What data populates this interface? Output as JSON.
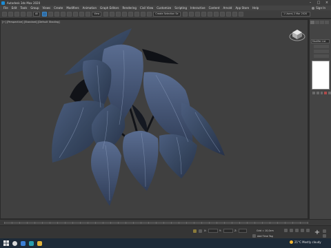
{
  "window": {
    "title": "Autodesk 3ds Max 2020"
  },
  "menubar": {
    "items": [
      "File",
      "Edit",
      "Tools",
      "Group",
      "Views",
      "Create",
      "Modifiers",
      "Animation",
      "Graph Editors",
      "Rendering",
      "Civil View",
      "Customize",
      "Scripting",
      "Interactive",
      "Content",
      "Arnold",
      "App Store",
      "Help"
    ],
    "signin_label": "Sign In"
  },
  "toolbar": {
    "filter_select": "All",
    "view_select": "View",
    "selection_set": "Create Selection Se",
    "workspace": "1 Users\\ 2 Mar 2020"
  },
  "viewport": {
    "label": "[+] [Perspective] [Standard] [Default Shading]"
  },
  "command_panel": {
    "modifier_list": "Modifier List"
  },
  "statusbar": {
    "grid_value": "Grid = 10,0cm",
    "add_time_tag": "Add Time Tag",
    "x_label": "X:",
    "y_label": "Y:",
    "z_label": "Z:"
  },
  "taskbar": {
    "weather": "21°C  Mostly cloudy"
  },
  "colors": {
    "leaf": "#36465f",
    "leaf_highlight": "#6d81a6",
    "stem": "#111318",
    "viewport_bg": "#404040"
  }
}
